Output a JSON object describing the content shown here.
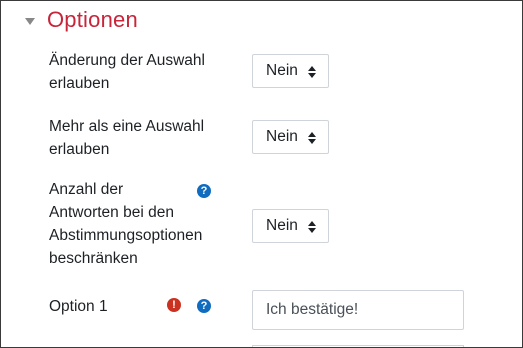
{
  "section": {
    "title": "Optionen"
  },
  "fields": [
    {
      "label_lines": [
        "Änderung der Auswahl",
        "erlauben"
      ],
      "value": "Nein"
    },
    {
      "label_lines": [
        "Mehr als eine Auswahl",
        "erlauben"
      ],
      "value": "Nein"
    },
    {
      "label_lines": [
        "Anzahl der",
        "Antworten bei den",
        "Abstimmungsoptionen",
        "beschränken"
      ],
      "value": "Nein",
      "help_icon": "question-circle-icon"
    }
  ],
  "option1": {
    "label": "Option 1",
    "value": "Ich bestätige!",
    "error_icon": "exclamation-circle-icon",
    "help_icon": "question-circle-icon"
  },
  "icons": {
    "help_glyph": "?",
    "error_glyph": "!"
  },
  "colors": {
    "section_title": "#c8243a",
    "help_icon": "#0f6cbf",
    "error_icon": "#ca3120"
  }
}
